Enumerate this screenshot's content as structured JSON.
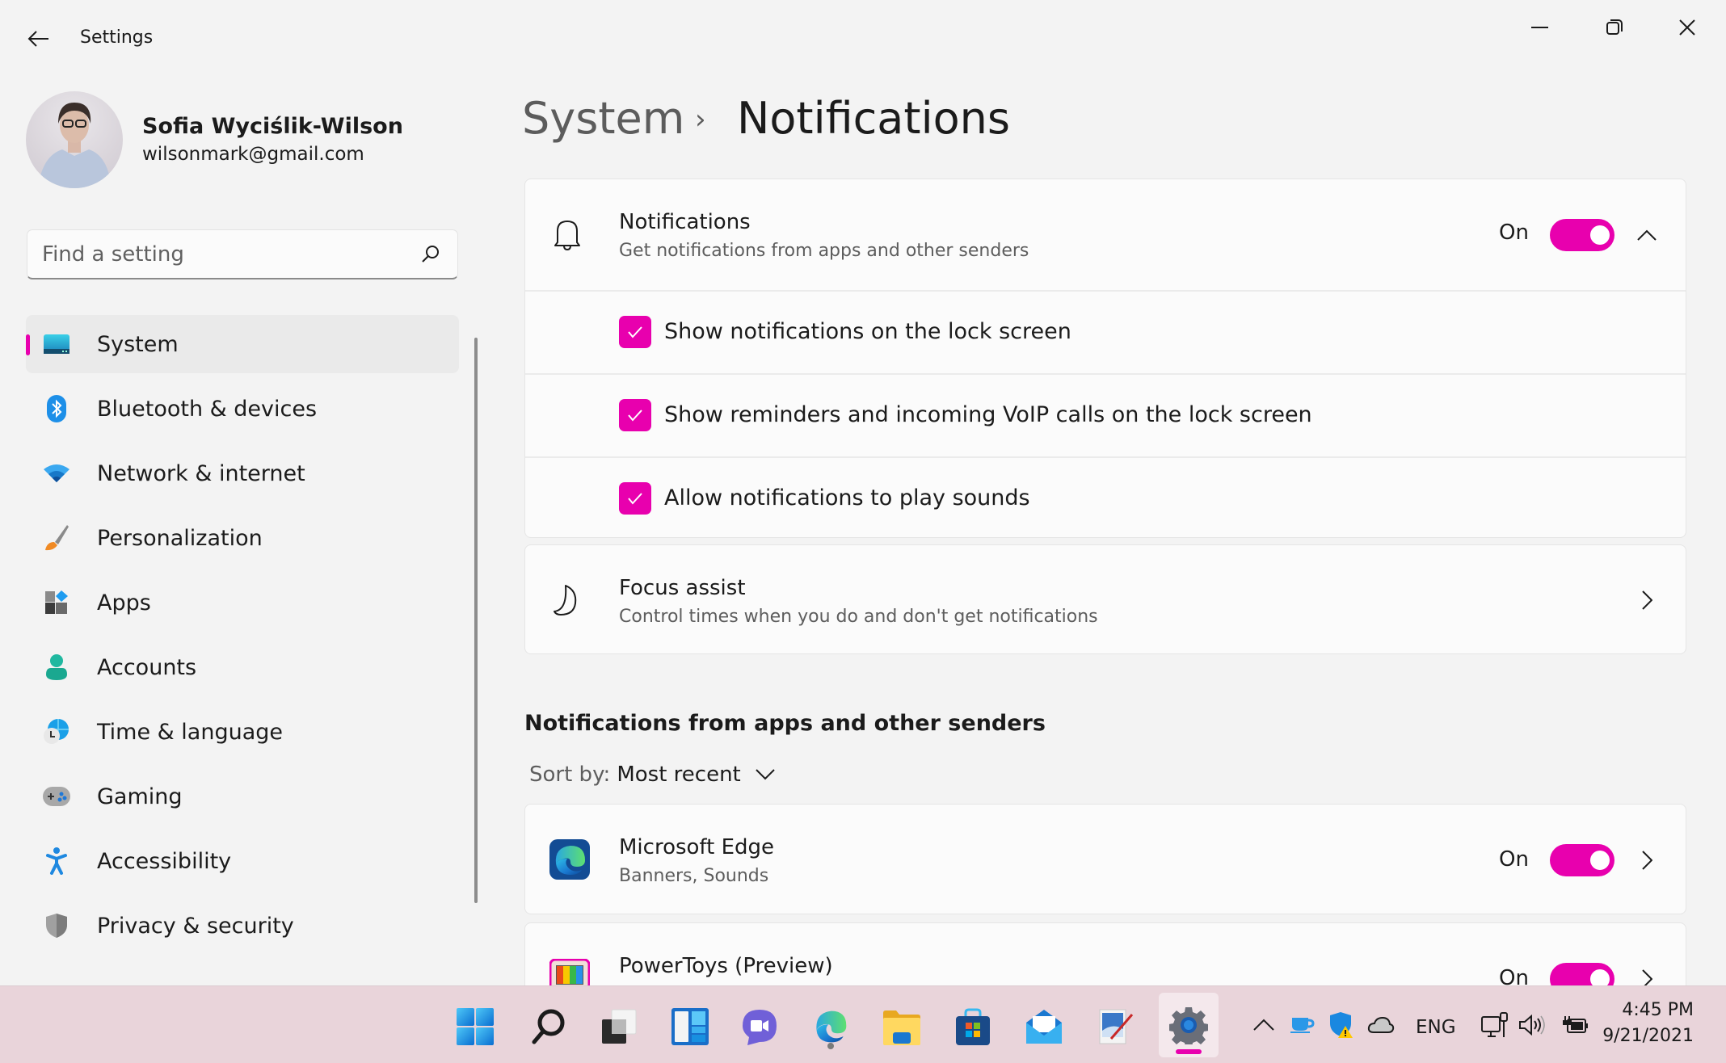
{
  "window": {
    "title": "Settings",
    "controls": {
      "minimize": "minimize-icon",
      "restore": "restore-icon",
      "close": "close-icon"
    }
  },
  "profile": {
    "name": "Sofia Wyciślik-Wilson",
    "email": "wilsonmark@gmail.com"
  },
  "search": {
    "placeholder": "Find a setting",
    "value": ""
  },
  "sidebar": {
    "items": [
      {
        "label": "System",
        "icon": "system-display-icon",
        "active": true
      },
      {
        "label": "Bluetooth & devices",
        "icon": "bluetooth-icon"
      },
      {
        "label": "Network & internet",
        "icon": "wifi-icon"
      },
      {
        "label": "Personalization",
        "icon": "paintbrush-icon"
      },
      {
        "label": "Apps",
        "icon": "apps-icon"
      },
      {
        "label": "Accounts",
        "icon": "person-icon"
      },
      {
        "label": "Time & language",
        "icon": "globe-clock-icon"
      },
      {
        "label": "Gaming",
        "icon": "gamepad-icon"
      },
      {
        "label": "Accessibility",
        "icon": "accessibility-icon"
      },
      {
        "label": "Privacy & security",
        "icon": "shield-icon"
      }
    ]
  },
  "breadcrumb": {
    "parent": "System",
    "separator": "›",
    "current": "Notifications"
  },
  "notifications_card": {
    "title": "Notifications",
    "subtitle": "Get notifications from apps and other senders",
    "state_label": "On",
    "enabled": true,
    "expanded": true,
    "options": [
      {
        "label": "Show notifications on the lock screen",
        "checked": true
      },
      {
        "label": "Show reminders and incoming VoIP calls on the lock screen",
        "checked": true
      },
      {
        "label": "Allow notifications to play sounds",
        "checked": true
      }
    ]
  },
  "focus_assist": {
    "title": "Focus assist",
    "subtitle": "Control times when you do and don't get notifications"
  },
  "apps_section": {
    "title": "Notifications from apps and other senders",
    "sort_label": "Sort by:",
    "sort_value": "Most recent",
    "apps": [
      {
        "name": "Microsoft Edge",
        "detail": "Banners, Sounds",
        "state_label": "On",
        "enabled": true
      },
      {
        "name": "PowerToys (Preview)",
        "detail": "",
        "state_label": "On",
        "enabled": true
      }
    ]
  },
  "taskbar": {
    "apps": [
      "start-icon",
      "search-icon",
      "task-view-icon",
      "widgets-icon",
      "teams-chat-icon",
      "edge-icon",
      "file-explorer-icon",
      "store-icon",
      "mail-icon",
      "paint-icon",
      "settings-icon"
    ],
    "tray": {
      "language": "ENG",
      "time": "4:45 PM",
      "date": "9/21/2021"
    }
  },
  "colors": {
    "accent": "#E800AE",
    "background": "#F3F3F3",
    "card": "#FBFBFB",
    "taskbar": "#E9D4DA"
  }
}
